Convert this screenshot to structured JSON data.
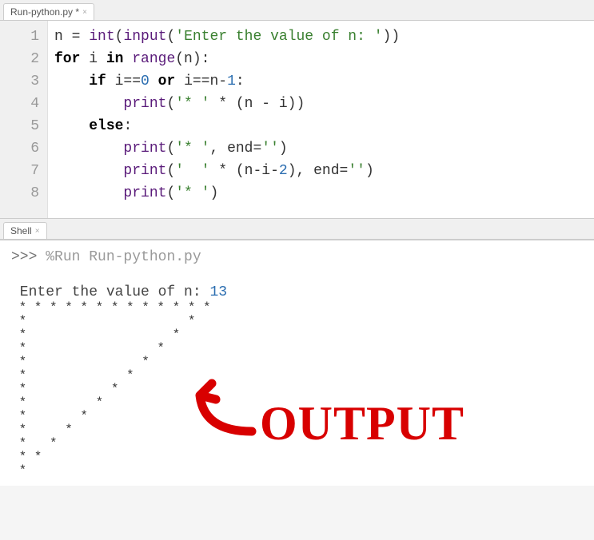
{
  "editor_tab": {
    "label": "Run-python.py *"
  },
  "gutter_lines": [
    "1",
    "2",
    "3",
    "4",
    "5",
    "6",
    "7",
    "8"
  ],
  "code": {
    "line1": {
      "t1": "n = ",
      "fn1": "int",
      "t2": "(",
      "fn2": "input",
      "t3": "(",
      "s1": "'Enter the value of n: '",
      "t4": "))"
    },
    "line2": {
      "kw1": "for",
      "t1": " i ",
      "kw2": "in",
      "t2": " ",
      "fn1": "range",
      "t3": "(n):"
    },
    "line3": {
      "pad": "    ",
      "kw1": "if",
      "t1": " i==",
      "n1": "0",
      "t2": " ",
      "kw2": "or",
      "t3": " i==n-",
      "n2": "1",
      "t4": ":"
    },
    "line4": {
      "pad": "        ",
      "fn1": "print",
      "t1": "(",
      "s1": "'* '",
      "t2": " * (n - i))"
    },
    "line5": {
      "pad": "    ",
      "kw1": "else",
      "t1": ":"
    },
    "line6": {
      "pad": "        ",
      "fn1": "print",
      "t1": "(",
      "s1": "'* '",
      "t2": ", end=",
      "s2": "''",
      "t3": ")"
    },
    "line7": {
      "pad": "        ",
      "fn1": "print",
      "t1": "(",
      "s1": "'  '",
      "t2": " * (n-i-",
      "n1": "2",
      "t3": "), end=",
      "s2": "''",
      "t4": ")"
    },
    "line8": {
      "pad": "        ",
      "fn1": "print",
      "t1": "(",
      "s1": "'* '",
      "t2": ")"
    }
  },
  "shell_tab": {
    "label": "Shell"
  },
  "shell": {
    "prompt": ">>> ",
    "cmd": "%Run Run-python.py",
    "input_prompt": " Enter the value of n: ",
    "input_value": "13",
    "pattern": [
      " * * * * * * * * * * * * *",
      " *                     *",
      " *                   *",
      " *                 *",
      " *               *",
      " *             *",
      " *           *",
      " *         *",
      " *       *",
      " *     *",
      " *   *",
      " * *",
      " *"
    ]
  },
  "annotation": {
    "text": "OUTPUT"
  }
}
